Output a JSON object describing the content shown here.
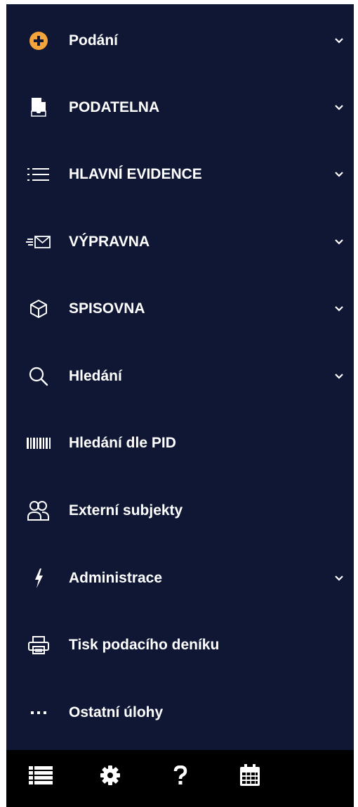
{
  "menu": {
    "items": [
      {
        "label": "Podání",
        "icon": "plus-circle-icon",
        "has_submenu": true
      },
      {
        "label": "PODATELNA",
        "icon": "document-inbox-icon",
        "has_submenu": true
      },
      {
        "label": "HLAVNÍ EVIDENCE",
        "icon": "list-icon",
        "has_submenu": true
      },
      {
        "label": "VÝPRAVNA",
        "icon": "send-envelope-icon",
        "has_submenu": true
      },
      {
        "label": "SPISOVNA",
        "icon": "archive-box-icon",
        "has_submenu": true
      },
      {
        "label": "Hledání",
        "icon": "search-icon",
        "has_submenu": true
      },
      {
        "label": "Hledání dle PID",
        "icon": "barcode-icon",
        "has_submenu": false
      },
      {
        "label": "Externí subjekty",
        "icon": "users-icon",
        "has_submenu": false
      },
      {
        "label": "Administrace",
        "icon": "lightning-icon",
        "has_submenu": true
      },
      {
        "label": "Tisk podacího deníku",
        "icon": "printer-icon",
        "has_submenu": false
      },
      {
        "label": "Ostatní úlohy",
        "icon": "more-dots-icon",
        "has_submenu": false
      }
    ]
  },
  "bottom_bar": {
    "buttons": [
      "list-icon",
      "gear-icon",
      "help-icon",
      "calendar-icon"
    ]
  },
  "colors": {
    "sidebar_bg": "#0f1734",
    "bottom_bar_bg": "#000000",
    "text": "#ffffff",
    "accent": "#f5a33b"
  }
}
